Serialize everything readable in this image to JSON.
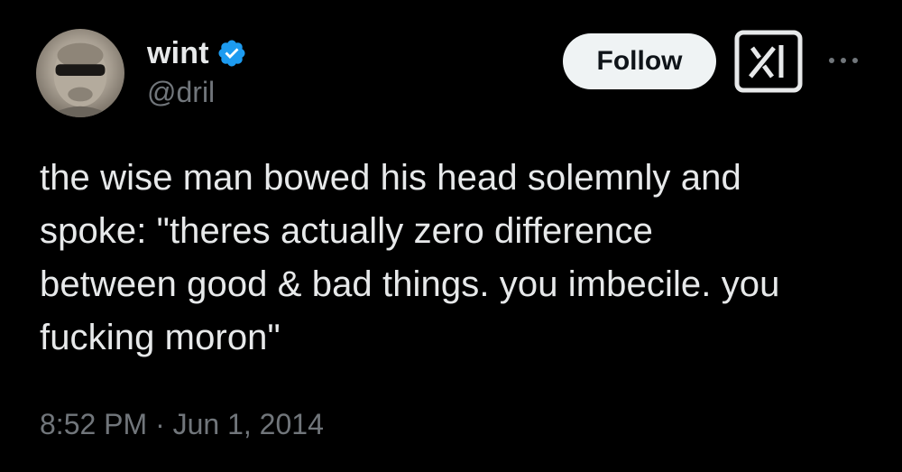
{
  "author": {
    "display_name": "wint",
    "handle": "@dril",
    "verified": true
  },
  "actions": {
    "follow_label": "Follow"
  },
  "tweet": {
    "text": "the wise man bowed his head solemnly and\nspoke: \"theres actually zero difference\nbetween good & bad things. you imbecile. you\nfucking moron\"",
    "time": "8:52 PM",
    "separator": "·",
    "date": "Jun 1, 2014"
  },
  "colors": {
    "background": "#000000",
    "primary_text": "#e7e9ea",
    "secondary_text": "#71767b",
    "verified_badge": "#1d9bf0",
    "follow_button_bg": "#eff3f4",
    "follow_button_text": "#0f1419"
  },
  "icons": {
    "verified": "verified-badge-icon",
    "grok": "grok-icon",
    "more": "more-options-icon"
  }
}
